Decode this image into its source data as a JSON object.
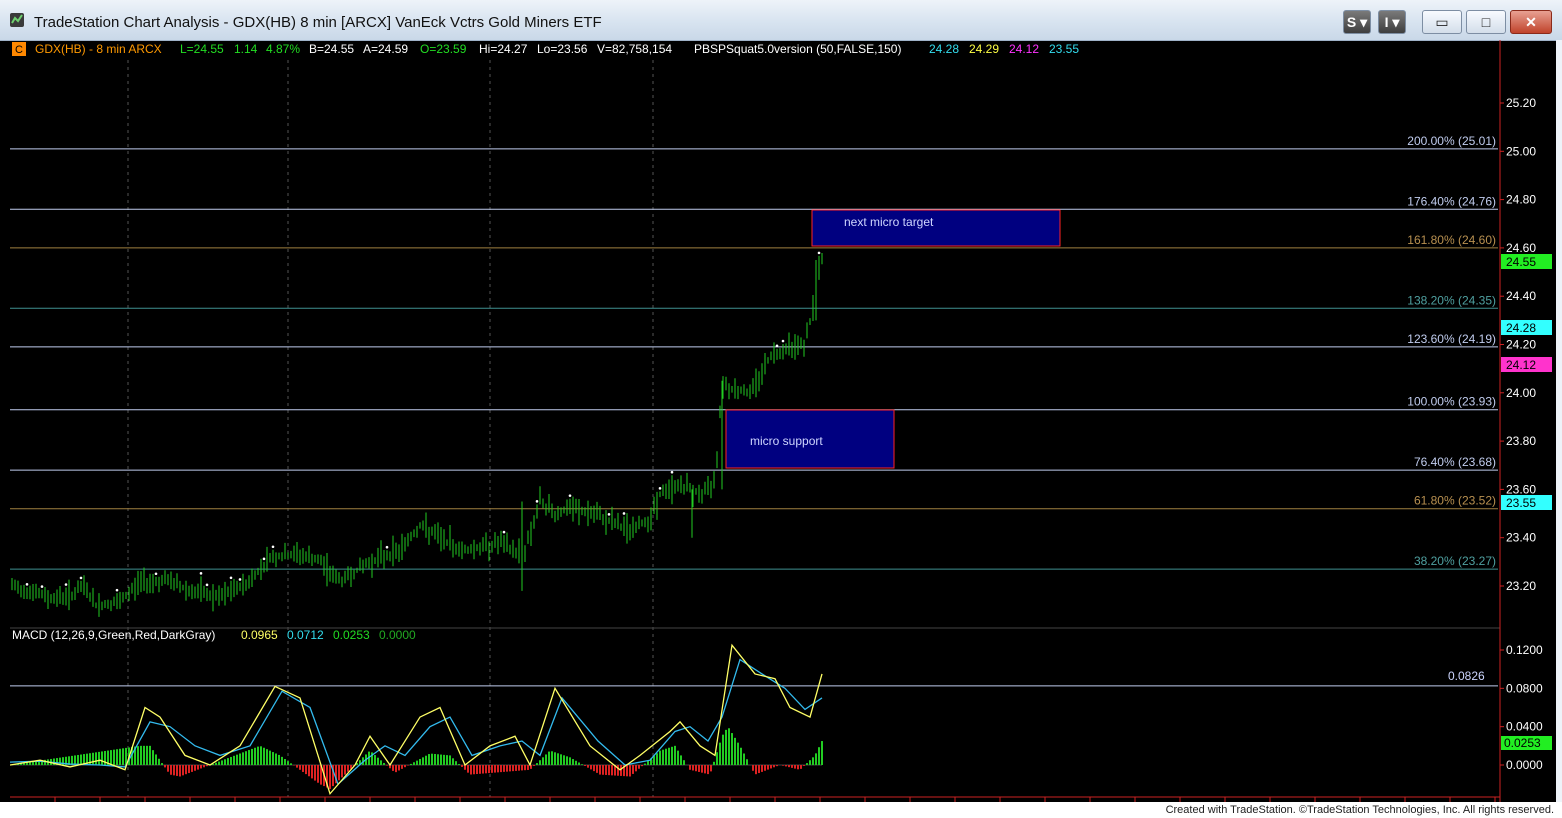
{
  "window": {
    "title": "TradeStation Chart Analysis - GDX(HB) 8 min [ARCX] VanEck Vctrs Gold Miners ETF",
    "btn_s": "S",
    "btn_i": "I",
    "btn_min": "▭",
    "btn_max": "□",
    "btn_close": "✕"
  },
  "colors": {
    "background": "#000000",
    "price_bars": "#22cc22",
    "macd_line": "#ffff66",
    "signal_line": "#33bbee",
    "hist_pos": "#22cc22",
    "hist_neg": "#dd2222",
    "box_fill": "#000080",
    "box_border": "#ff2222"
  },
  "header": {
    "c_badge": "C",
    "symbol": "GDX(HB) - 8 min  ARCX",
    "last": "L=24.55",
    "chg": "1.14",
    "pct": "4.87%",
    "bid": "B=24.55",
    "ask": "A=24.59",
    "open": "O=23.59",
    "high": "Hi=24.27",
    "low": "Lo=23.56",
    "volume": "V=82,758,154",
    "indicator": "PBSPSquat5.0version (50,FALSE,150)",
    "ind_v1": "24.28",
    "ind_v2": "24.29",
    "ind_v3": "24.12",
    "ind_v4": "23.55"
  },
  "price_axis": [
    "25.20",
    "25.00",
    "24.80",
    "24.60",
    "24.40",
    "24.20",
    "24.00",
    "23.80",
    "23.60",
    "23.40",
    "23.20"
  ],
  "price_badges": {
    "last": "24.55",
    "b1": "24.28",
    "b2": "24.12",
    "b3": "23.55"
  },
  "fib_levels": [
    {
      "label": "200.00% (25.01)",
      "price": 25.01
    },
    {
      "label": "176.40% (24.76)",
      "price": 24.76
    },
    {
      "label": "161.80% (24.60)",
      "price": 24.6
    },
    {
      "label": "138.20% (24.35)",
      "price": 24.35
    },
    {
      "label": "123.60% (24.19)",
      "price": 24.19
    },
    {
      "label": "100.00% (23.93)",
      "price": 23.93
    },
    {
      "label": "76.40% (23.68)",
      "price": 23.68
    },
    {
      "label": "61.80% (23.52)",
      "price": 23.52
    },
    {
      "label": "38.20% (23.27)",
      "price": 23.27
    }
  ],
  "annotations": {
    "target_box": "next micro target",
    "support_box": "micro support"
  },
  "macd": {
    "label": "MACD (12,26,9,Green,Red,DarkGray)",
    "v_macd": "0.0965",
    "v_signal": "0.0712",
    "v_hist": "0.0253",
    "v_zero": "0.0000",
    "axis": [
      "0.1200",
      "0.0800",
      "0.0400",
      "0.0000"
    ],
    "hline_label": "0.0826",
    "hist_badge": "0.0253"
  },
  "chart_data": {
    "type": "ohlc",
    "price_range": [
      23.1,
      25.3
    ],
    "macd_range": [
      -0.03,
      0.13
    ],
    "close_path": [
      [
        0,
        23.2
      ],
      [
        20,
        23.18
      ],
      [
        40,
        23.15
      ],
      [
        60,
        23.16
      ],
      [
        75,
        23.2
      ],
      [
        85,
        23.12
      ],
      [
        110,
        23.13
      ],
      [
        130,
        23.22
      ],
      [
        160,
        23.22
      ],
      [
        180,
        23.18
      ],
      [
        210,
        23.15
      ],
      [
        240,
        23.22
      ],
      [
        260,
        23.32
      ],
      [
        290,
        23.33
      ],
      [
        310,
        23.3
      ],
      [
        330,
        23.22
      ],
      [
        360,
        23.3
      ],
      [
        390,
        23.35
      ],
      [
        410,
        23.45
      ],
      [
        430,
        23.4
      ],
      [
        450,
        23.35
      ],
      [
        470,
        23.36
      ],
      [
        490,
        23.38
      ],
      [
        505,
        23.34
      ],
      [
        515,
        23.35
      ],
      [
        530,
        23.55
      ],
      [
        545,
        23.5
      ],
      [
        560,
        23.52
      ],
      [
        580,
        23.5
      ],
      [
        600,
        23.47
      ],
      [
        620,
        23.43
      ],
      [
        640,
        23.48
      ],
      [
        650,
        23.58
      ],
      [
        670,
        23.62
      ],
      [
        690,
        23.58
      ],
      [
        700,
        23.6
      ],
      [
        706,
        23.68
      ],
      [
        712,
        24.05
      ],
      [
        720,
        24.02
      ],
      [
        740,
        24.0
      ],
      [
        760,
        24.15
      ],
      [
        780,
        24.2
      ],
      [
        795,
        24.2
      ],
      [
        803,
        24.35
      ],
      [
        808,
        24.5
      ],
      [
        812,
        24.55
      ]
    ],
    "macd_line": [
      [
        0,
        0.0
      ],
      [
        30,
        0.005
      ],
      [
        60,
        -0.002
      ],
      [
        90,
        0.005
      ],
      [
        115,
        -0.005
      ],
      [
        135,
        0.06
      ],
      [
        150,
        0.05
      ],
      [
        175,
        0.01
      ],
      [
        200,
        0.0
      ],
      [
        230,
        0.02
      ],
      [
        265,
        0.082
      ],
      [
        290,
        0.07
      ],
      [
        320,
        -0.03
      ],
      [
        345,
        0.0
      ],
      [
        360,
        0.03
      ],
      [
        380,
        0.0
      ],
      [
        410,
        0.05
      ],
      [
        430,
        0.06
      ],
      [
        455,
        0.0
      ],
      [
        480,
        0.02
      ],
      [
        505,
        0.03
      ],
      [
        520,
        0.0
      ],
      [
        545,
        0.08
      ],
      [
        580,
        0.02
      ],
      [
        610,
        -0.005
      ],
      [
        630,
        0.01
      ],
      [
        660,
        0.035
      ],
      [
        670,
        0.045
      ],
      [
        690,
        0.02
      ],
      [
        705,
        0.01
      ],
      [
        722,
        0.125
      ],
      [
        745,
        0.095
      ],
      [
        765,
        0.09
      ],
      [
        780,
        0.06
      ],
      [
        800,
        0.05
      ],
      [
        812,
        0.095
      ]
    ],
    "signal_line": [
      [
        0,
        0.003
      ],
      [
        30,
        0.004
      ],
      [
        60,
        0.001
      ],
      [
        90,
        0.0
      ],
      [
        115,
        -0.002
      ],
      [
        140,
        0.045
      ],
      [
        160,
        0.04
      ],
      [
        185,
        0.02
      ],
      [
        210,
        0.01
      ],
      [
        240,
        0.02
      ],
      [
        272,
        0.077
      ],
      [
        300,
        0.06
      ],
      [
        328,
        -0.02
      ],
      [
        355,
        0.005
      ],
      [
        375,
        0.02
      ],
      [
        395,
        0.01
      ],
      [
        420,
        0.04
      ],
      [
        440,
        0.05
      ],
      [
        462,
        0.01
      ],
      [
        490,
        0.02
      ],
      [
        512,
        0.025
      ],
      [
        530,
        0.01
      ],
      [
        552,
        0.07
      ],
      [
        588,
        0.025
      ],
      [
        615,
        0.0
      ],
      [
        640,
        0.005
      ],
      [
        665,
        0.035
      ],
      [
        680,
        0.04
      ],
      [
        698,
        0.025
      ],
      [
        712,
        0.05
      ],
      [
        730,
        0.11
      ],
      [
        752,
        0.095
      ],
      [
        775,
        0.08
      ],
      [
        795,
        0.058
      ],
      [
        812,
        0.07
      ]
    ],
    "histogram": [
      [
        130,
        0.02
      ],
      [
        140,
        0.02
      ],
      [
        160,
        -0.01
      ],
      [
        170,
        -0.012
      ],
      [
        250,
        0.02
      ],
      [
        270,
        0.01
      ],
      [
        310,
        -0.02
      ],
      [
        320,
        -0.025
      ],
      [
        360,
        0.015
      ],
      [
        385,
        -0.008
      ],
      [
        420,
        0.012
      ],
      [
        440,
        0.01
      ],
      [
        460,
        -0.01
      ],
      [
        520,
        -0.005
      ],
      [
        540,
        0.015
      ],
      [
        560,
        0.008
      ],
      [
        590,
        -0.01
      ],
      [
        620,
        -0.012
      ],
      [
        650,
        0.015
      ],
      [
        665,
        0.02
      ],
      [
        680,
        -0.005
      ],
      [
        700,
        -0.01
      ],
      [
        712,
        0.03
      ],
      [
        718,
        0.04
      ],
      [
        730,
        0.02
      ],
      [
        745,
        -0.01
      ],
      [
        770,
        0.0
      ],
      [
        790,
        -0.005
      ],
      [
        805,
        0.01
      ],
      [
        812,
        0.025
      ]
    ]
  }
}
